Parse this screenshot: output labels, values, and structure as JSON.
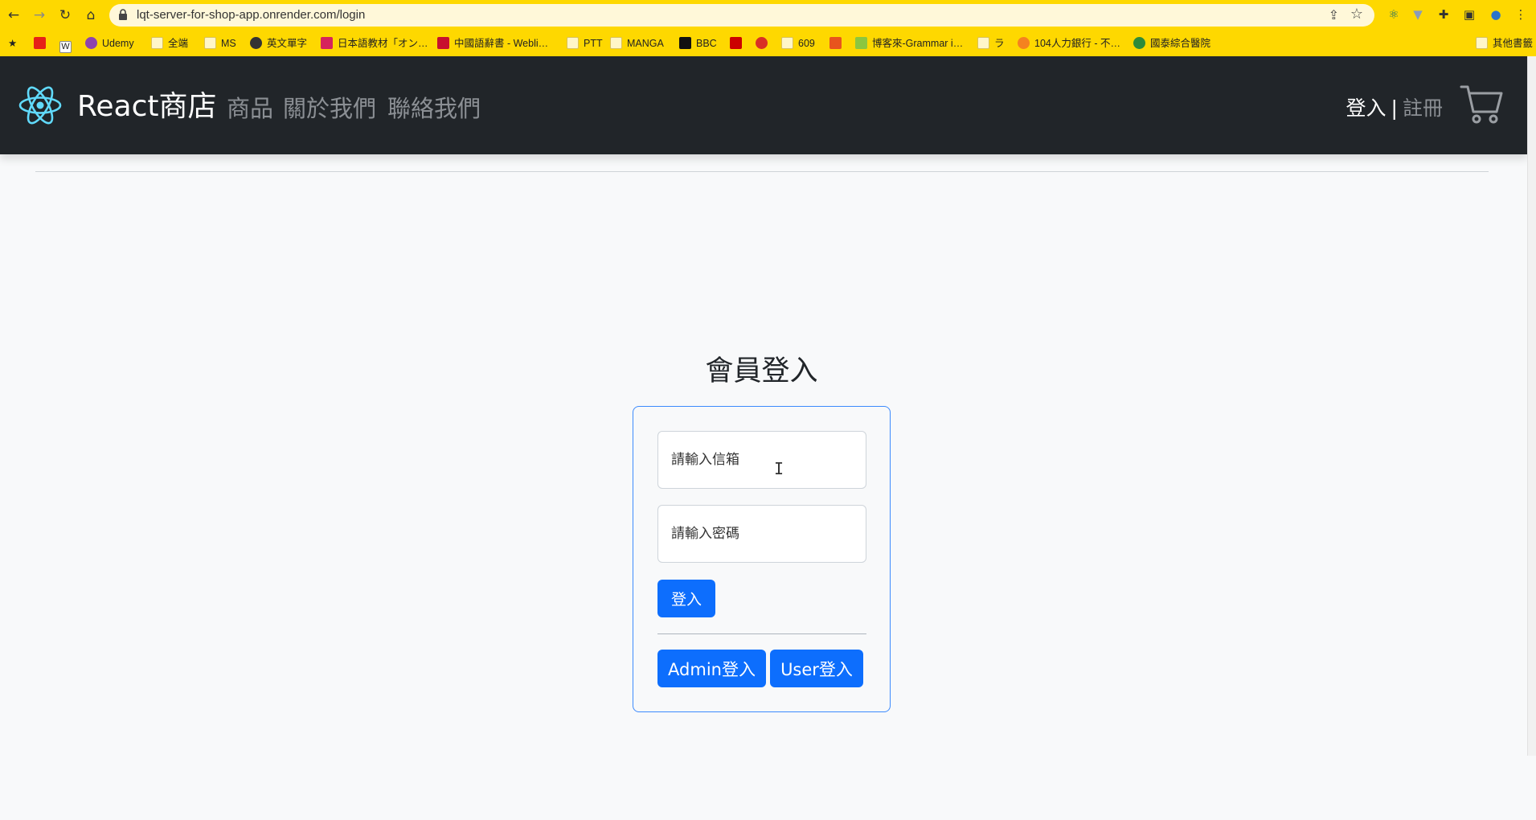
{
  "browser": {
    "url": "lqt-server-for-shop-app.onrender.com/login",
    "bookmarks": [
      {
        "label": "",
        "icon": "star-icon"
      },
      {
        "label": "",
        "icon": "youtube-icon"
      },
      {
        "label": "",
        "icon": "wikipedia-icon"
      },
      {
        "label": "Udemy",
        "icon": "udemy-icon"
      },
      {
        "label": "全端",
        "icon": "folder-icon"
      },
      {
        "label": "MS",
        "icon": "folder-icon"
      },
      {
        "label": "英文單字",
        "icon": "globe-icon"
      },
      {
        "label": "日本語教材「オン…",
        "icon": "bookmark-icon"
      },
      {
        "label": "中國語辭書 - Webli…",
        "icon": "weblio-icon"
      },
      {
        "label": "PTT",
        "icon": "folder-icon"
      },
      {
        "label": "MANGA",
        "icon": "folder-icon"
      },
      {
        "label": "BBC",
        "icon": "bbc-icon"
      },
      {
        "label": "",
        "icon": "cnn-icon"
      },
      {
        "label": "",
        "icon": "gmail-icon"
      },
      {
        "label": "609",
        "icon": "folder-icon"
      },
      {
        "label": "",
        "icon": "app-icon"
      },
      {
        "label": "博客來-Grammar i…",
        "icon": "books-icon"
      },
      {
        "label": "ラ",
        "icon": "folder-icon"
      },
      {
        "label": "104人力銀行 - 不…",
        "icon": "104-icon"
      },
      {
        "label": "國泰綜合醫院",
        "icon": "hospital-icon"
      },
      {
        "label": "其他書籤",
        "icon": "folder-icon"
      }
    ]
  },
  "header": {
    "brand": "React商店",
    "nav": [
      "商品",
      "關於我們",
      "聯絡我們"
    ],
    "login": "登入",
    "separator": "|",
    "register": "註冊"
  },
  "login": {
    "title": "會員登入",
    "email_placeholder": "請輸入信箱",
    "password_placeholder": "請輸入密碼",
    "submit": "登入",
    "admin_button": "Admin登入",
    "user_button": "User登入"
  },
  "colors": {
    "primary": "#0d6efd",
    "header_bg": "#212529",
    "chrome_bg": "#fed800"
  }
}
